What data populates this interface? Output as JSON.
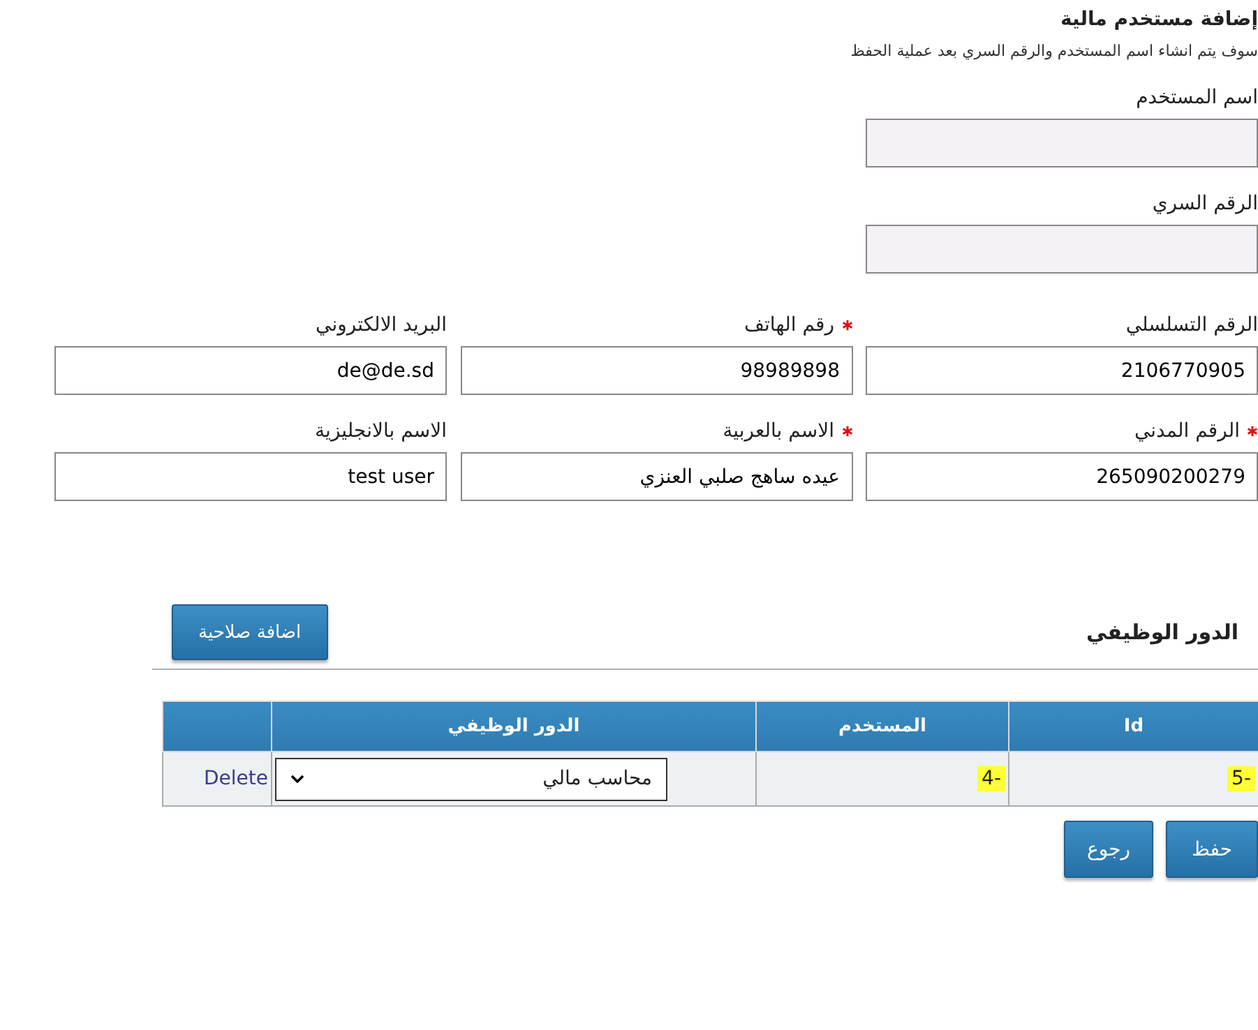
{
  "title": "إضافة مستخدم مالية",
  "note": "سوف يتم انشاء اسم المستخدم والرقم السري بعد عملية الحفظ",
  "account_fields": [
    {
      "label": "اسم المستخدم"
    },
    {
      "label": "الرقم السري"
    }
  ],
  "fields": [
    {
      "label": "الرقم التسلسلي",
      "required": false,
      "value": "2106770905"
    },
    {
      "label": "رقم الهاتف",
      "required": true,
      "value": "98989898"
    },
    {
      "label": "البريد الالكتروني",
      "required": false,
      "value": "de@de.sd"
    },
    {
      "label": "الرقم المدني",
      "required": true,
      "value": "265090200279"
    },
    {
      "label": "الاسم بالعربية",
      "required": true,
      "value": "عيده ساهج صلبي العنزي"
    },
    {
      "label": "الاسم بالانجليزية",
      "required": false,
      "value": "test user"
    }
  ],
  "roles_section": {
    "title": "الدور الوظيفي",
    "add_button": "اضافة صلاحية",
    "table": {
      "columns": [
        "Id",
        "المستخدم",
        "الدور الوظيفي"
      ],
      "rows": [
        [
          {
            "kind": "text",
            "text": "5-",
            "highlighted": true
          },
          {
            "kind": "text",
            "text": "4-",
            "highlighted": true
          },
          {
            "kind": "select",
            "value": "محاسب مالي"
          },
          {
            "kind": "link",
            "text": "Delete"
          }
        ]
      ]
    }
  },
  "buttons": [
    "حفظ",
    "رجوع"
  ]
}
